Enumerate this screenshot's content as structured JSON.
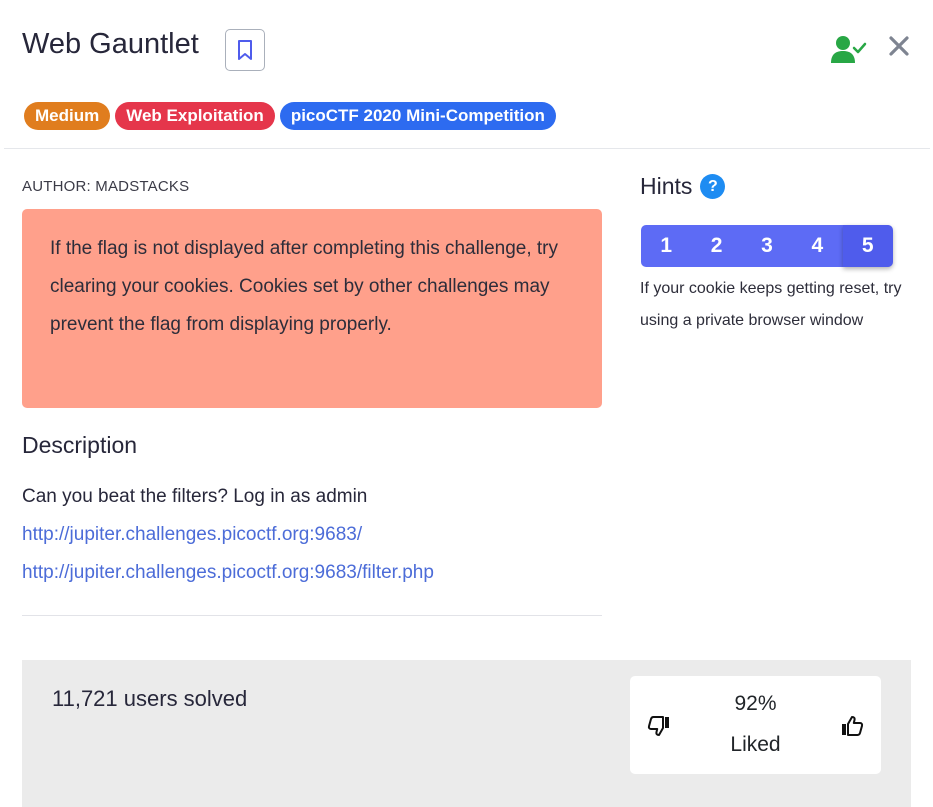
{
  "header": {
    "title": "Web Gauntlet",
    "bookmark_icon": "bookmark-icon",
    "user_icon": "user-check-icon",
    "close_icon": "close-icon"
  },
  "tags": [
    {
      "label": "Medium",
      "color": "#e07d1e"
    },
    {
      "label": "Web Exploitation",
      "color": "#e5364b"
    },
    {
      "label": "picoCTF 2020 Mini-Competition",
      "color": "#2d6bf0"
    }
  ],
  "author": "AUTHOR: MADSTACKS",
  "alert": {
    "text": "If the flag is not displayed after completing this challenge, try clearing your cookies. Cookies set by other challenges may prevent the flag from displaying properly.",
    "color": "#ffa08b"
  },
  "description": {
    "heading": "Description",
    "text": "Can you beat the filters? Log in as admin",
    "links": [
      "http://jupiter.challenges.picoctf.org:9683/",
      "http://jupiter.challenges.picoctf.org:9683/filter.php"
    ],
    "link_color": "#4c6cd8"
  },
  "hints": {
    "title": "Hints",
    "help_icon": "?",
    "buttons": [
      "1",
      "2",
      "3",
      "4",
      "5"
    ],
    "active_index": 4,
    "button_color": "#5d6bf5",
    "active_color": "#4f5cec",
    "text": "If your cookie keeps getting reset, try using a private browser window"
  },
  "footer": {
    "solved": "11,721 users solved",
    "liked_percent": "92%",
    "liked_label": "Liked",
    "dislike_icon": "thumbs-down-icon",
    "like_icon": "thumbs-up-icon"
  },
  "colors": {
    "check_green": "#28a745",
    "close_gray": "#7e8491",
    "bookmark_blue": "#4f5cec"
  }
}
